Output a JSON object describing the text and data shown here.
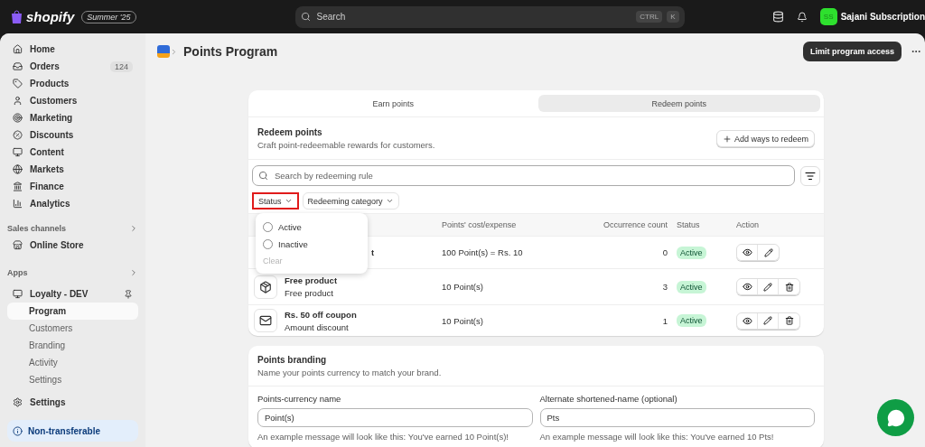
{
  "topbar": {
    "brand": "shopify",
    "edition": "Summer '25",
    "search": {
      "placeholder": "Search"
    },
    "shortcut": [
      "CTRL",
      "K"
    ],
    "store": {
      "initials": "SS",
      "name": "Sajani Subscription"
    }
  },
  "sidebar": {
    "main": [
      {
        "label": "Home",
        "selected": false
      },
      {
        "label": "Orders",
        "selected": false,
        "badge": "124"
      },
      {
        "label": "Products",
        "selected": false
      },
      {
        "label": "Customers",
        "selected": false
      },
      {
        "label": "Marketing",
        "selected": false
      },
      {
        "label": "Discounts",
        "selected": false
      },
      {
        "label": "Content",
        "selected": false
      },
      {
        "label": "Markets",
        "selected": false
      },
      {
        "label": "Finance",
        "selected": false
      },
      {
        "label": "Analytics",
        "selected": false
      }
    ],
    "sales_channels": {
      "heading": "Sales channels",
      "items": [
        {
          "label": "Online Store",
          "selected": false
        }
      ]
    },
    "apps": {
      "heading": "Apps",
      "app": {
        "label": "Loyalty - DEV",
        "children": [
          {
            "label": "Program",
            "selected": true
          },
          {
            "label": "Customers",
            "selected": false
          },
          {
            "label": "Branding",
            "selected": false
          },
          {
            "label": "Activity",
            "selected": false
          },
          {
            "label": "Settings",
            "selected": false
          }
        ]
      }
    },
    "settings": "Settings",
    "notice": "Non-transferable"
  },
  "page": {
    "title": "Points Program",
    "action": "Limit program access"
  },
  "tabs": [
    {
      "label": "Earn points",
      "selected": false
    },
    {
      "label": "Redeem points",
      "selected": true
    }
  ],
  "redeem": {
    "title": "Redeem points",
    "subtitle": "Craft point-redeemable rewards for customers.",
    "add_button": "Add ways to redeem",
    "search": {
      "placeholder": "Search by redeeming rule"
    },
    "filters": [
      {
        "label": "Status",
        "highlighted": true
      },
      {
        "label": "Redeeming category",
        "highlighted": false
      }
    ],
    "status_menu": {
      "options": [
        {
          "label": "Active",
          "selected": false
        },
        {
          "label": "Inactive",
          "selected": false
        }
      ],
      "clear": "Clear"
    },
    "columns": [
      "Points' cost/expense",
      "Occurrence count",
      "Status",
      "Action"
    ],
    "rows": [
      {
        "kind": "hidden",
        "title": "t",
        "cost": "100 Point(s) = Rs. 10",
        "count": "0",
        "status": "Active",
        "deletable": false
      },
      {
        "kind": "product",
        "title": "Free product",
        "subtitle": "Free product",
        "cost": "10 Point(s)",
        "count": "3",
        "status": "Active",
        "deletable": true
      },
      {
        "kind": "coupon",
        "title": "Rs. 50 off coupon",
        "subtitle": "Amount discount",
        "cost": "10 Point(s)",
        "count": "1",
        "status": "Active",
        "deletable": true
      }
    ]
  },
  "branding": {
    "title": "Points branding",
    "subtitle": "Name your points currency to match your brand.",
    "fields": [
      {
        "label": "Points-currency name",
        "value": "Point(s)",
        "hint": "An example message will look like this: You've earned 10 Point(s)!"
      },
      {
        "label": "Alternate shortened-name (optional)",
        "value": "Pts",
        "hint": "An example message will look like this: You've earned 10 Pts!"
      }
    ]
  }
}
